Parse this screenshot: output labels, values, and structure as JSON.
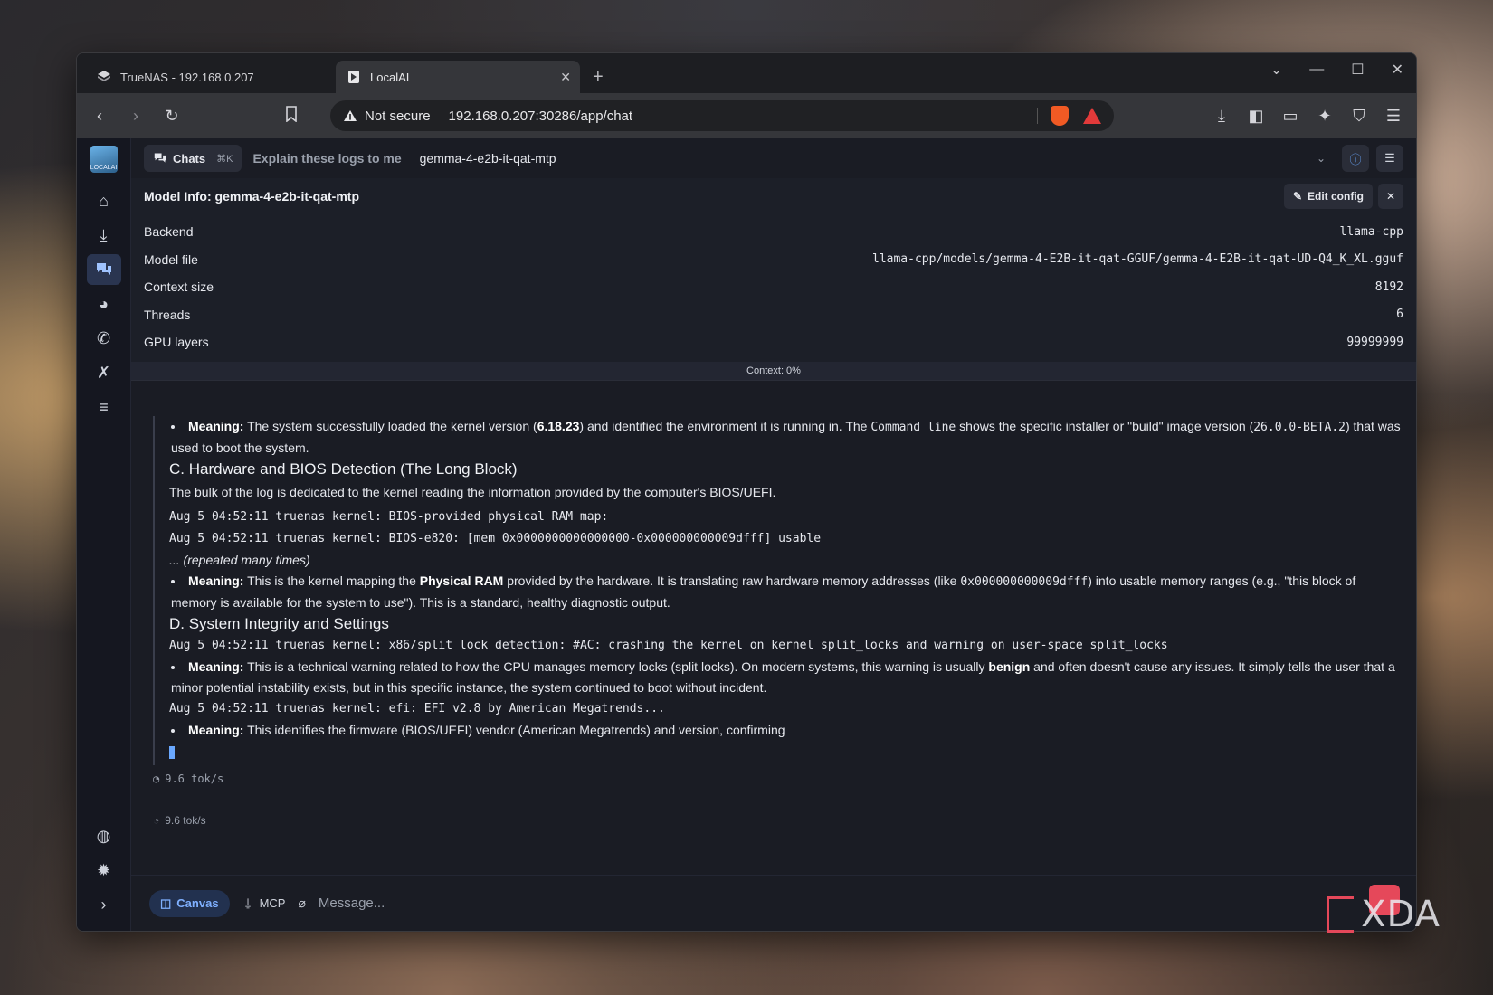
{
  "browser": {
    "tabs": [
      {
        "title": "TrueNAS - 192.168.0.207",
        "active": false
      },
      {
        "title": "LocalAI",
        "active": true
      }
    ],
    "new_tab_label": "+",
    "security_label": "Not secure",
    "url": "192.168.0.207:30286/app/chat"
  },
  "app": {
    "logo_text": "LOCALAI",
    "topbar": {
      "chats_label": "Chats",
      "chats_shortcut": "⌘K",
      "chat_title": "Explain these logs to me",
      "model": "gemma-4-e2b-it-qat-mtp"
    },
    "model_info": {
      "title": "Model Info: gemma-4-e2b-it-qat-mtp",
      "edit_label": "Edit config",
      "rows": [
        {
          "label": "Backend",
          "value": "llama-cpp"
        },
        {
          "label": "Model file",
          "value": "llama-cpp/models/gemma-4-E2B-it-qat-GGUF/gemma-4-E2B-it-qat-UD-Q4_K_XL.gguf"
        },
        {
          "label": "Context size",
          "value": "8192"
        },
        {
          "label": "Threads",
          "value": "6"
        },
        {
          "label": "GPU layers",
          "value": "99999999"
        }
      ]
    },
    "context_label": "Context: 0%",
    "message": {
      "m1_label": "Meaning:",
      "m1_a": " The system successfully loaded the kernel version (",
      "m1_b": "6.18.23",
      "m1_c": ") and identified the environment it is running in. The ",
      "m1_d": "Command line",
      "m1_e": " shows the specific installer or \"build\" image version (",
      "m1_f": "26.0.0-BETA.2",
      "m1_g": ") that was used to boot the system.",
      "h_c": "C. Hardware and BIOS Detection (The Long Block)",
      "p_c": "The bulk of the log is dedicated to the kernel reading the information provided by the computer's BIOS/UEFI.",
      "code1": "Aug 5 04:52:11 truenas kernel: BIOS-provided physical RAM map:",
      "code2": "Aug 5 04:52:11 truenas kernel: BIOS-e820: [mem 0x0000000000000000-0x000000000009dfff] usable",
      "repeated": "... (repeated many times)",
      "m2_label": "Meaning:",
      "m2_a": " This is the kernel mapping the ",
      "m2_b": "Physical RAM",
      "m2_c": " provided by the hardware. It is translating raw hardware memory addresses (like ",
      "m2_d": "0x000000000009dfff",
      "m2_e": ") into usable memory ranges (e.g., \"this block of memory is available for the system to use\"). This is a standard, healthy diagnostic output.",
      "h_d": "D. System Integrity and Settings",
      "code3": "Aug 5 04:52:11 truenas kernel: x86/split lock detection: #AC: crashing the kernel on kernel split_locks and warning on user-space split_locks",
      "m3_label": "Meaning:",
      "m3_a": " This is a technical warning related to how the CPU manages memory locks (split locks). On modern systems, this warning is usually ",
      "m3_b": "benign",
      "m3_c": " and often doesn't cause any issues. It simply tells the user that a minor potential instability exists, but in this specific instance, the system continued to boot without incident.",
      "code4": "Aug 5 04:52:11 truenas kernel: efi: EFI v2.8 by American Megatrends...",
      "m4_label": "Meaning:",
      "m4_a": " This identifies the firmware (BIOS/UEFI) vendor (American Megatrends) and version, confirming",
      "tok_rate": "9.6 tok/s"
    },
    "tok_rate_footer": "9.6 tok/s",
    "composer": {
      "canvas_label": "Canvas",
      "mcp_label": "MCP",
      "placeholder": "Message..."
    }
  },
  "watermark": "XDA"
}
